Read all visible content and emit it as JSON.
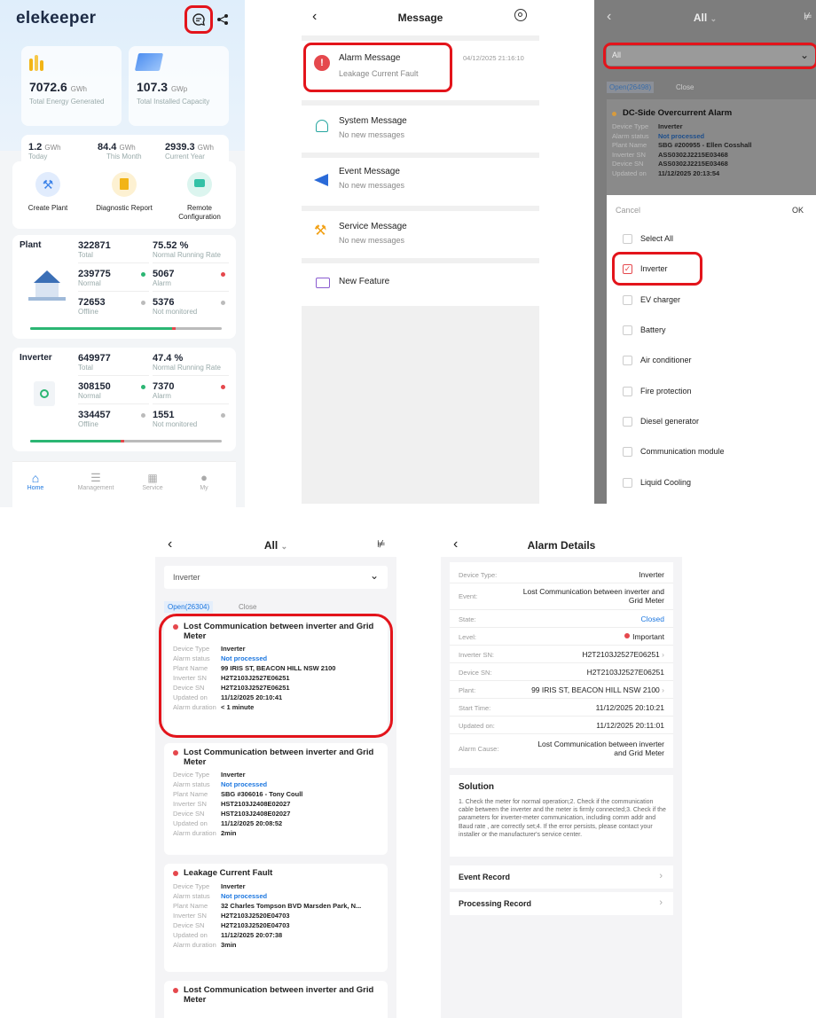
{
  "screen1": {
    "logo": "elekeeper",
    "energy_generated": {
      "value": "7072.6",
      "unit": "GWh",
      "label": "Total Energy Generated"
    },
    "installed_capacity": {
      "value": "107.3",
      "unit": "GWp",
      "label": "Total Installed Capacity"
    },
    "stats": [
      {
        "value": "1.2",
        "unit": "GWh",
        "label": "Today"
      },
      {
        "value": "84.4",
        "unit": "GWh",
        "label": "This Month"
      },
      {
        "value": "2939.3",
        "unit": "GWh",
        "label": "Current Year"
      }
    ],
    "actions": [
      {
        "label": "Create Plant",
        "icon": "wrench-icon",
        "color": "#3b82e8"
      },
      {
        "label": "Diagnostic Report",
        "icon": "report-icon",
        "color": "#f2b416"
      },
      {
        "label": "Remote Configuration",
        "icon": "remote-config-icon",
        "color": "#33c1a6"
      }
    ],
    "plant": {
      "title": "Plant",
      "total": {
        "value": "322871",
        "label": "Total"
      },
      "rate": {
        "value": "75.52 %",
        "label": "Normal Running Rate"
      },
      "normal": {
        "value": "239775",
        "label": "Normal"
      },
      "alarm": {
        "value": "5067",
        "label": "Alarm"
      },
      "offline": {
        "value": "72653",
        "label": "Offline"
      },
      "not_monitored": {
        "value": "5376",
        "label": "Not monitored"
      }
    },
    "inverter": {
      "title": "Inverter",
      "total": {
        "value": "649977",
        "label": "Total"
      },
      "rate": {
        "value": "47.4 %",
        "label": "Normal Running Rate"
      },
      "normal": {
        "value": "308150",
        "label": "Normal"
      },
      "alarm": {
        "value": "7370",
        "label": "Alarm"
      },
      "offline": {
        "value": "334457",
        "label": "Offline"
      },
      "not_monitored": {
        "value": "1551",
        "label": "Not monitored"
      }
    },
    "nav": [
      {
        "label": "Home",
        "icon": "home-icon"
      },
      {
        "label": "Management",
        "icon": "list-icon"
      },
      {
        "label": "Service",
        "icon": "service-icon"
      },
      {
        "label": "My",
        "icon": "user-icon"
      }
    ]
  },
  "screen2": {
    "title": "Message",
    "items": [
      {
        "title": "Alarm Message",
        "subtitle": "Leakage Current Fault",
        "time": "04/12/2025 21:16:10",
        "icon": "alarm-icon"
      },
      {
        "title": "System Message",
        "subtitle": "No new messages",
        "icon": "bell-icon"
      },
      {
        "title": "Event Message",
        "subtitle": "No new messages",
        "icon": "megaphone-icon"
      },
      {
        "title": "Service Message",
        "subtitle": "No new messages",
        "icon": "wrench-icon"
      },
      {
        "title": "New Feature",
        "icon": "new-feature-icon"
      }
    ]
  },
  "screen3": {
    "title": "All",
    "filter_value": "All",
    "tabs": [
      "Open(26498)",
      "Close"
    ],
    "alarm": {
      "title": "DC-Side Overcurrent Alarm",
      "fields": [
        {
          "label": "Device Type",
          "value": "Inverter"
        },
        {
          "label": "Alarm status",
          "value": "Not processed"
        },
        {
          "label": "Plant Name",
          "value": "SBG #200955 - Ellen Cosshall"
        },
        {
          "label": "Inverter SN",
          "value": "ASS0302J2215E03468"
        },
        {
          "label": "Device SN",
          "value": "ASS0302J2215E03468"
        },
        {
          "label": "Updated on",
          "value": "11/12/2025 20:13:54"
        }
      ]
    },
    "cancel": "Cancel",
    "ok": "OK",
    "options": [
      "Select All",
      "Inverter",
      "EV charger",
      "Battery",
      "Air conditioner",
      "Fire protection",
      "Diesel generator",
      "Communication module",
      "Liquid Cooling"
    ]
  },
  "screen4": {
    "title": "All",
    "filter_value": "Inverter",
    "tabs": [
      "Open(26304)",
      "Close"
    ],
    "labels": [
      "Device Type",
      "Alarm status",
      "Plant Name",
      "Inverter SN",
      "Device SN",
      "Updated on",
      "Alarm duration"
    ],
    "alarms": [
      {
        "title": "Lost Communication between inverter and Grid Meter",
        "values": [
          "Inverter",
          "Not processed",
          "99 IRIS ST, BEACON HILL NSW 2100",
          "H2T2103J2527E06251",
          "H2T2103J2527E06251",
          "11/12/2025 20:10:41",
          "< 1 minute"
        ]
      },
      {
        "title": "Lost Communication between inverter and Grid Meter",
        "values": [
          "Inverter",
          "Not processed",
          "SBG #306016 - Tony Coull",
          "HST2103J2408E02027",
          "HST2103J2408E02027",
          "11/12/2025 20:08:52",
          "2min"
        ]
      },
      {
        "title": "Leakage Current Fault",
        "values": [
          "Inverter",
          "Not processed",
          "32 Charles Tompson BVD Marsden Park, N...",
          "H2T2103J2520E04703",
          "H2T2103J2520E04703",
          "11/12/2025 20:07:38",
          "3min"
        ]
      },
      {
        "title": "Lost Communication between inverter and Grid Meter",
        "values": []
      }
    ]
  },
  "screen5": {
    "title": "Alarm Details",
    "rows": [
      {
        "label": "Device Type:",
        "value": "Inverter"
      },
      {
        "label": "Event:",
        "value": "Lost Communication between inverter and Grid Meter"
      },
      {
        "label": "State:",
        "value": "Closed"
      },
      {
        "label": "Level:",
        "value": "Important"
      },
      {
        "label": "Inverter SN:",
        "value": "H2T2103J2527E06251"
      },
      {
        "label": "Device SN:",
        "value": "H2T2103J2527E06251"
      },
      {
        "label": "Plant:",
        "value": "99 IRIS ST, BEACON HILL NSW 2100"
      },
      {
        "label": "Start Time:",
        "value": "11/12/2025 20:10:21"
      },
      {
        "label": "Updated on:",
        "value": "11/12/2025 20:11:01"
      },
      {
        "label": "Alarm Cause:",
        "value": "Lost Communication between inverter and Grid Meter"
      }
    ],
    "solution_title": "Solution",
    "solution_text": "1. Check the meter for normal operation;2. Check if the communication cable between the inverter and the meter is firmly connected;3. Check if the parameters for inverter-meter communication, including  comm addr and  Baud rate  , are correctly set;4. If the error persists, please contact your installer or the manufacturer's service center.",
    "event_record": "Event Record",
    "processing_record": "Processing Record"
  },
  "colors": {
    "highlight": "#e3141b",
    "blue": "#1e78e0",
    "green": "#2bb673",
    "red": "#e5484d"
  }
}
